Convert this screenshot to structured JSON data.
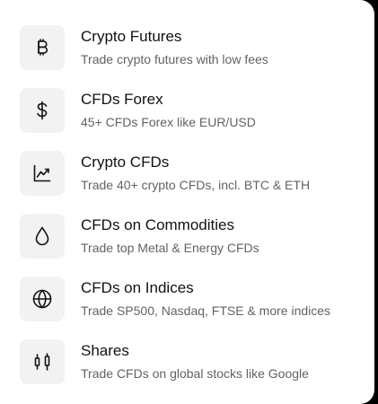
{
  "menu": {
    "items": [
      {
        "icon": "bitcoin-icon",
        "title": "Crypto Futures",
        "subtitle": "Trade crypto futures with low fees"
      },
      {
        "icon": "dollar-icon",
        "title": "CFDs Forex",
        "subtitle": "45+ CFDs Forex like EUR/USD"
      },
      {
        "icon": "trend-chart-icon",
        "title": "Crypto CFDs",
        "subtitle": "Trade 40+ crypto CFDs, incl. BTC & ETH"
      },
      {
        "icon": "drop-icon",
        "title": "CFDs on Commodities",
        "subtitle": "Trade top Metal & Energy CFDs"
      },
      {
        "icon": "globe-icon",
        "title": "CFDs on Indices",
        "subtitle": "Trade SP500, Nasdaq, FTSE & more indices"
      },
      {
        "icon": "candlestick-icon",
        "title": "Shares",
        "subtitle": "Trade CFDs on global stocks like Google"
      }
    ]
  },
  "colors": {
    "panel_background": "#ffffff",
    "icon_background": "#f2f2f3",
    "title_text": "#111111",
    "subtitle_text": "#5f6368"
  }
}
